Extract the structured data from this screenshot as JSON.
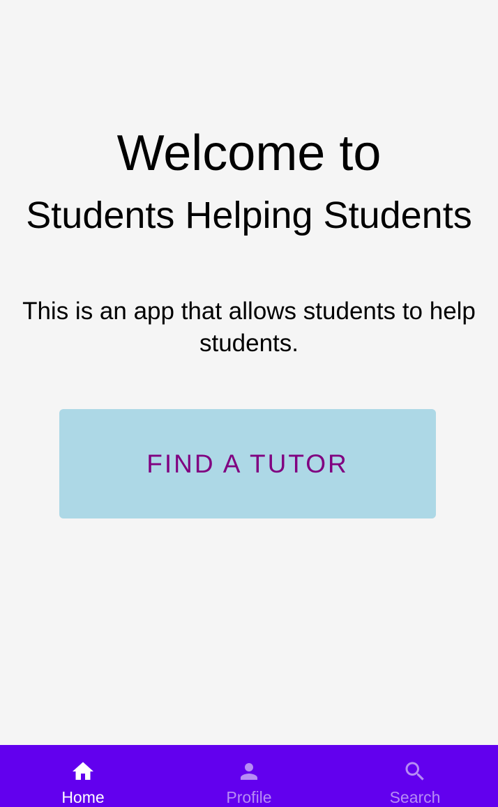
{
  "main": {
    "welcome_line": "Welcome to",
    "app_name": "Students Helping Students",
    "description": "This is an app that allows students to help students.",
    "find_tutor_label": "FIND A TUTOR"
  },
  "bottom_nav": {
    "items": [
      {
        "label": "Home",
        "icon": "home-icon",
        "active": true
      },
      {
        "label": "Profile",
        "icon": "person-icon",
        "active": false
      },
      {
        "label": "Search",
        "icon": "search-icon",
        "active": false
      }
    ]
  },
  "colors": {
    "background": "#f5f5f5",
    "nav_background": "#6200ee",
    "button_background": "#add8e6",
    "button_text": "#800080",
    "nav_active": "#ffffff",
    "nav_inactive": "#b78cf5"
  }
}
